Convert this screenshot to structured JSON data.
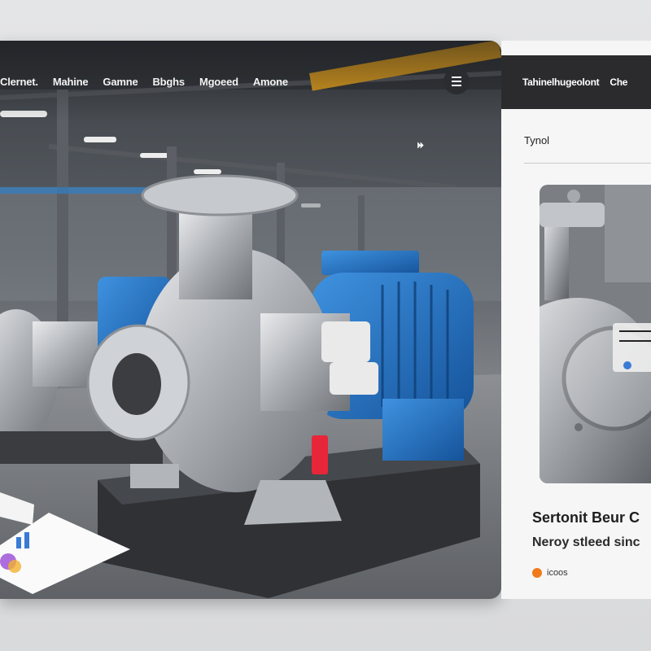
{
  "nav": {
    "items": [
      "Clernet.",
      "Mahine",
      "Gamne",
      "Bbghs",
      "Mgoeed",
      "Amone"
    ],
    "menu_icon": "hamburger-menu-icon"
  },
  "hero": {
    "play_icon": "⏵⏵"
  },
  "panel": {
    "header": "Tahinelhugeolont",
    "header_overflow": "Che",
    "label": "Tynol",
    "title": "Sertonit Beur C",
    "subtitle": "Neroy stleed sinc",
    "tag": {
      "color": "#f07a1a",
      "text": "icoos"
    }
  },
  "colors": {
    "motor_blue": "#1f73c4",
    "steel": "#b9bcc0",
    "accent_orange": "#f07a1a",
    "crane_yellow": "#e1a01f"
  }
}
